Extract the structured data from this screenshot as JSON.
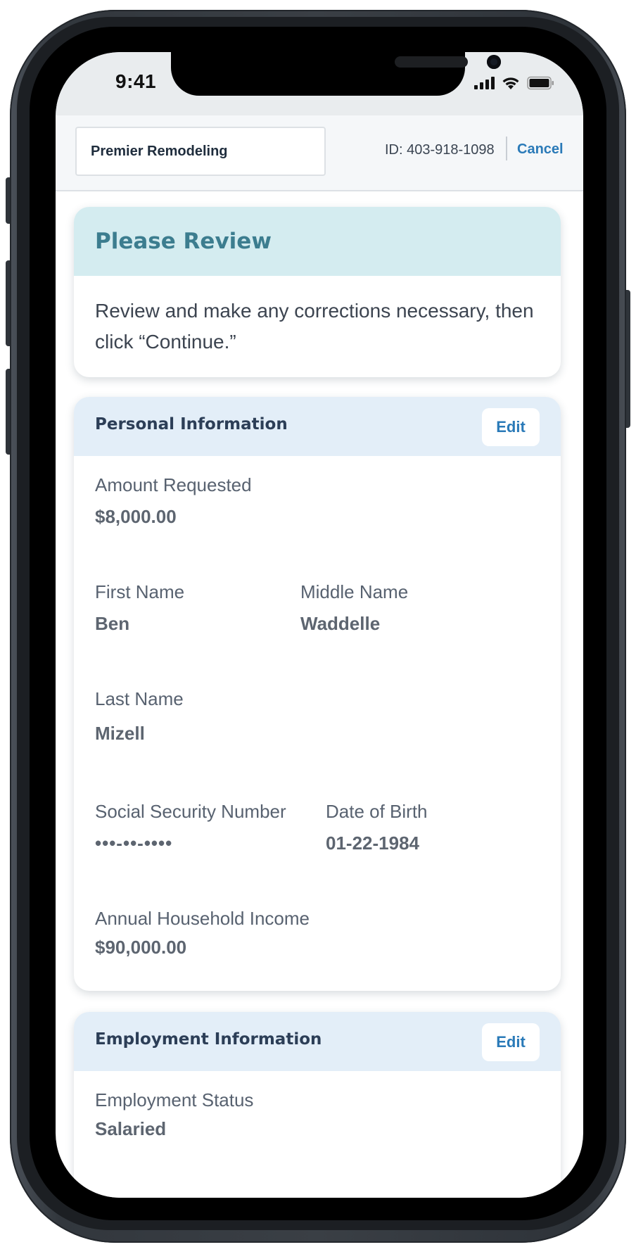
{
  "status_bar": {
    "time": "9:41"
  },
  "header": {
    "merchant_name": "Premier Remodeling",
    "id_text": "ID: 403-918-1098",
    "cancel_label": "Cancel"
  },
  "review": {
    "title": "Please Review",
    "body_line1": "Review and make any corrections necessary, then",
    "body_line2": "click “Continue.”"
  },
  "personal": {
    "title": "Personal Information",
    "edit_label": "Edit",
    "amount_requested": {
      "label": "Amount Requested",
      "value": "$8,000.00"
    },
    "first_name": {
      "label": "First Name",
      "value": "Ben"
    },
    "middle_name": {
      "label": "Middle Name",
      "value": "Waddelle"
    },
    "last_name": {
      "label": "Last Name",
      "value": "Mizell"
    },
    "ssn": {
      "label": "Social Security Number",
      "value": "•••-••-••••"
    },
    "dob": {
      "label": "Date of Birth",
      "value": "01-22-1984"
    },
    "income": {
      "label": "Annual Household Income",
      "value": "$90,000.00"
    }
  },
  "employment": {
    "title": "Employment Information",
    "edit_label": "Edit",
    "status": {
      "label": "Employment Status",
      "value": "Salaried"
    }
  },
  "colors": {
    "accent_link": "#2a7ab8",
    "review_header_bg": "#d4ecf0",
    "section_header_bg": "#e3eef8"
  },
  "icons": [
    "cellular-signal-icon",
    "wifi-icon",
    "battery-icon"
  ]
}
